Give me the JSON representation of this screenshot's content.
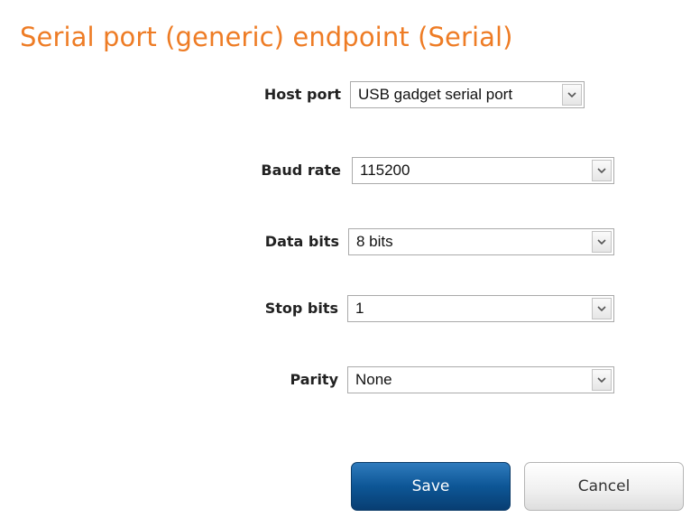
{
  "page": {
    "title": "Serial port (generic) endpoint (Serial)"
  },
  "form": {
    "fields": [
      {
        "label": "Host port",
        "value": "USB gadget serial port"
      },
      {
        "label": "Baud rate",
        "value": "115200"
      },
      {
        "label": "Data bits",
        "value": "8 bits"
      },
      {
        "label": "Stop bits",
        "value": "1"
      },
      {
        "label": "Parity",
        "value": "None"
      }
    ]
  },
  "actions": {
    "save_label": "Save",
    "cancel_label": "Cancel"
  },
  "icons": {
    "dropdown": "chevron-down-icon"
  },
  "colors": {
    "title": "#ee7c25",
    "save_button": "#0d5696",
    "cancel_button": "#f1f1f1",
    "background": "#ffffff",
    "outer_background": "#ececec"
  }
}
